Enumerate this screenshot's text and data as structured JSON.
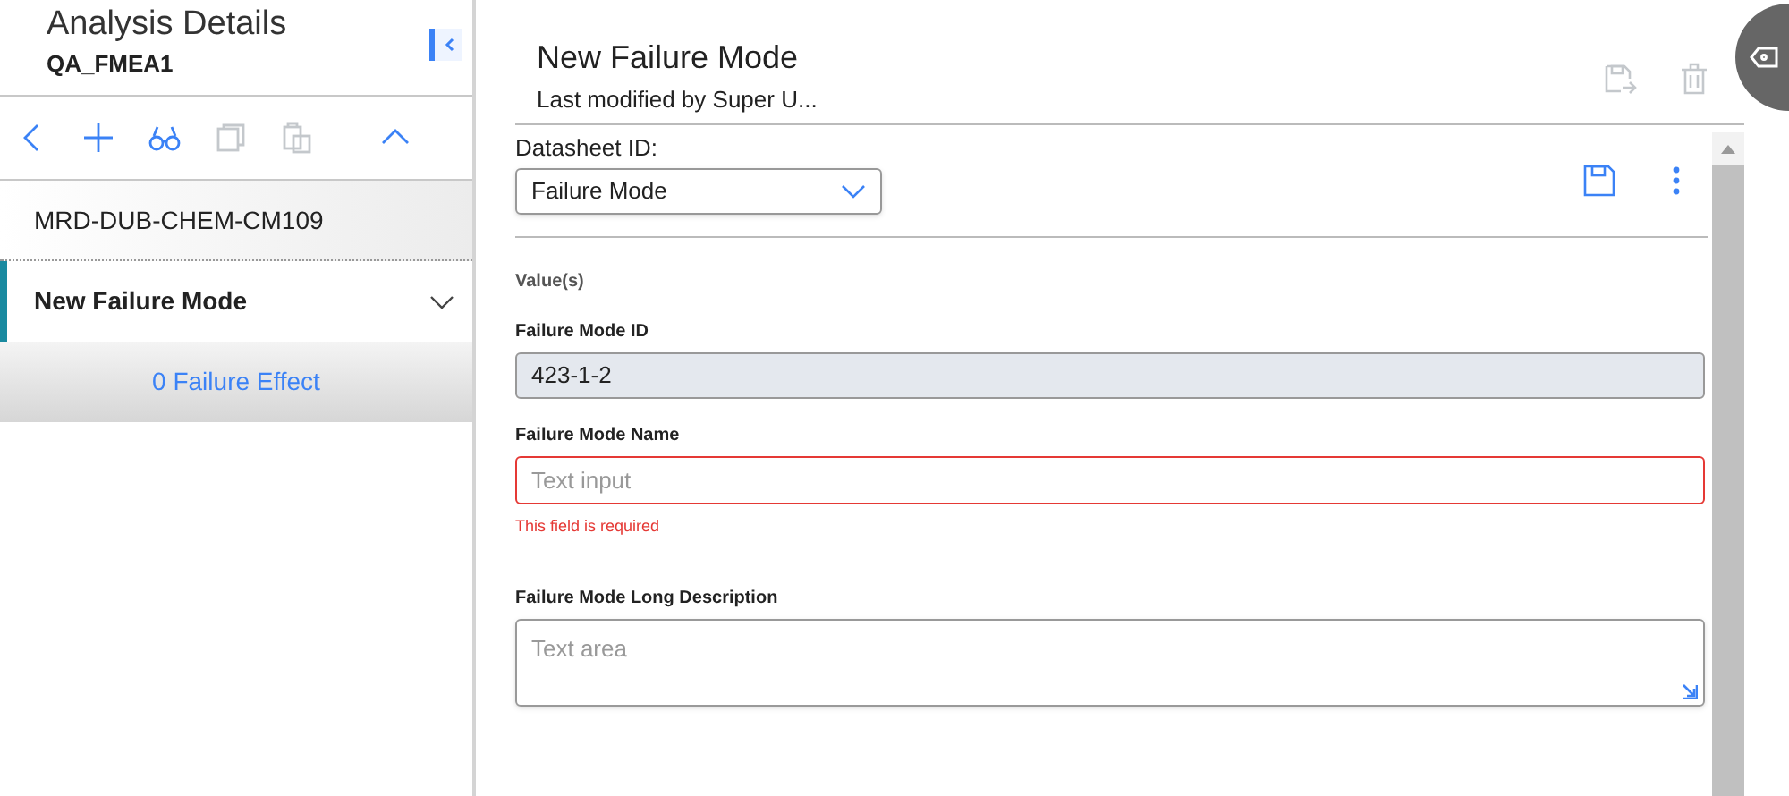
{
  "sidebar": {
    "title": "Analysis Details",
    "subtitle": "QA_FMEA1",
    "toolbar": [
      {
        "kind": "back",
        "disabled": false
      },
      {
        "kind": "add",
        "disabled": false
      },
      {
        "kind": "search",
        "disabled": false
      },
      {
        "kind": "copy",
        "disabled": true
      },
      {
        "kind": "paste",
        "disabled": true
      },
      {
        "kind": "collapse",
        "disabled": false
      }
    ],
    "items": [
      {
        "label": "MRD-DUB-CHEM-CM109",
        "kind": "node",
        "selected": false
      },
      {
        "label": "New Failure Mode",
        "kind": "node",
        "selected": true,
        "expanded": false
      },
      {
        "label": "0 Failure Effect",
        "kind": "link",
        "selected": false
      }
    ]
  },
  "header": {
    "title": "New Failure Mode",
    "subtitle": "Last modified by Super U...",
    "actions": [
      {
        "kind": "save-as",
        "disabled": true
      },
      {
        "kind": "delete",
        "disabled": true
      }
    ]
  },
  "form": {
    "datasheet_label": "Datasheet ID:",
    "datasheet_value": "Failure Mode",
    "section": "Value(s)",
    "fields": [
      {
        "kind": "readonly",
        "label": "Failure Mode ID",
        "value": "423-1-2"
      },
      {
        "kind": "text",
        "label": "Failure Mode Name",
        "placeholder": "Text input",
        "error": "This field is required"
      },
      {
        "kind": "textarea",
        "label": "Failure Mode Long Description",
        "placeholder": "Text area"
      }
    ]
  }
}
